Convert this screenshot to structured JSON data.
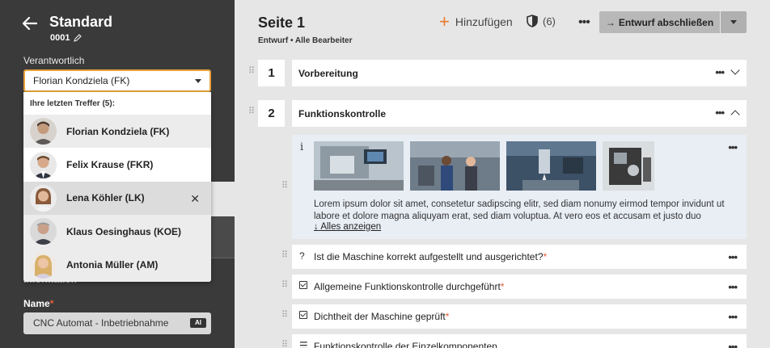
{
  "sidebar": {
    "title": "Standard",
    "code": "0001",
    "responsible_label": "Verantwortlich",
    "responsible_value": "Florian Kondziela (FK)",
    "info_label": "Information",
    "name_label": "Name",
    "name_required": "*",
    "name_value": "CNC Automat - Inbetriebnahme",
    "name_icon": "AI"
  },
  "dropdown": {
    "header": "Ihre letzten Treffer (5):",
    "items": [
      {
        "label": "Florian Kondziela (FK)"
      },
      {
        "label": "Felix Krause (FKR)"
      },
      {
        "label": "Lena Köhler (LK)",
        "selected": true
      },
      {
        "label": "Klaus Oesinghaus (KOE)"
      },
      {
        "label": "Antonia Müller (AM)"
      }
    ]
  },
  "main": {
    "title": "Seite 1",
    "status": "Entwurf",
    "editors": "Alle Bearbeiter",
    "add_label": "Hinzufügen",
    "shield_count": "(6)",
    "finish_label": "Entwurf abschließen",
    "sections": [
      {
        "number": "1",
        "title": "Vorbereitung"
      },
      {
        "number": "2",
        "title": "Funktionskontrolle"
      }
    ],
    "media": {
      "text": "Lorem ipsum dolor sit amet, consetetur sadipscing elitr, sed diam nonumy eirmod tempor invidunt ut labore et dolore magna aliquyam erat, sed diam voluptua. At vero eos et accusam et justo duo dolores et e...",
      "show_all": "Alles anzeigen"
    },
    "questions": [
      {
        "icon": "?",
        "text": "Ist die Maschine korrekt aufgestellt und ausgerichtet?",
        "required": "*"
      },
      {
        "icon": "checkbox",
        "text": "Allgemeine Funktionskontrolle durchgeführt",
        "required": "*"
      },
      {
        "icon": "checkbox",
        "text": "Dichtheit der Maschine geprüft",
        "required": "*"
      },
      {
        "icon": "list",
        "text": "Funktionskontrolle der Einzelkomponenten",
        "required": ""
      }
    ]
  },
  "colors": {
    "accent": "#e87a2a",
    "sidebar": "#3a3a3a",
    "focus": "#e8a23a"
  }
}
